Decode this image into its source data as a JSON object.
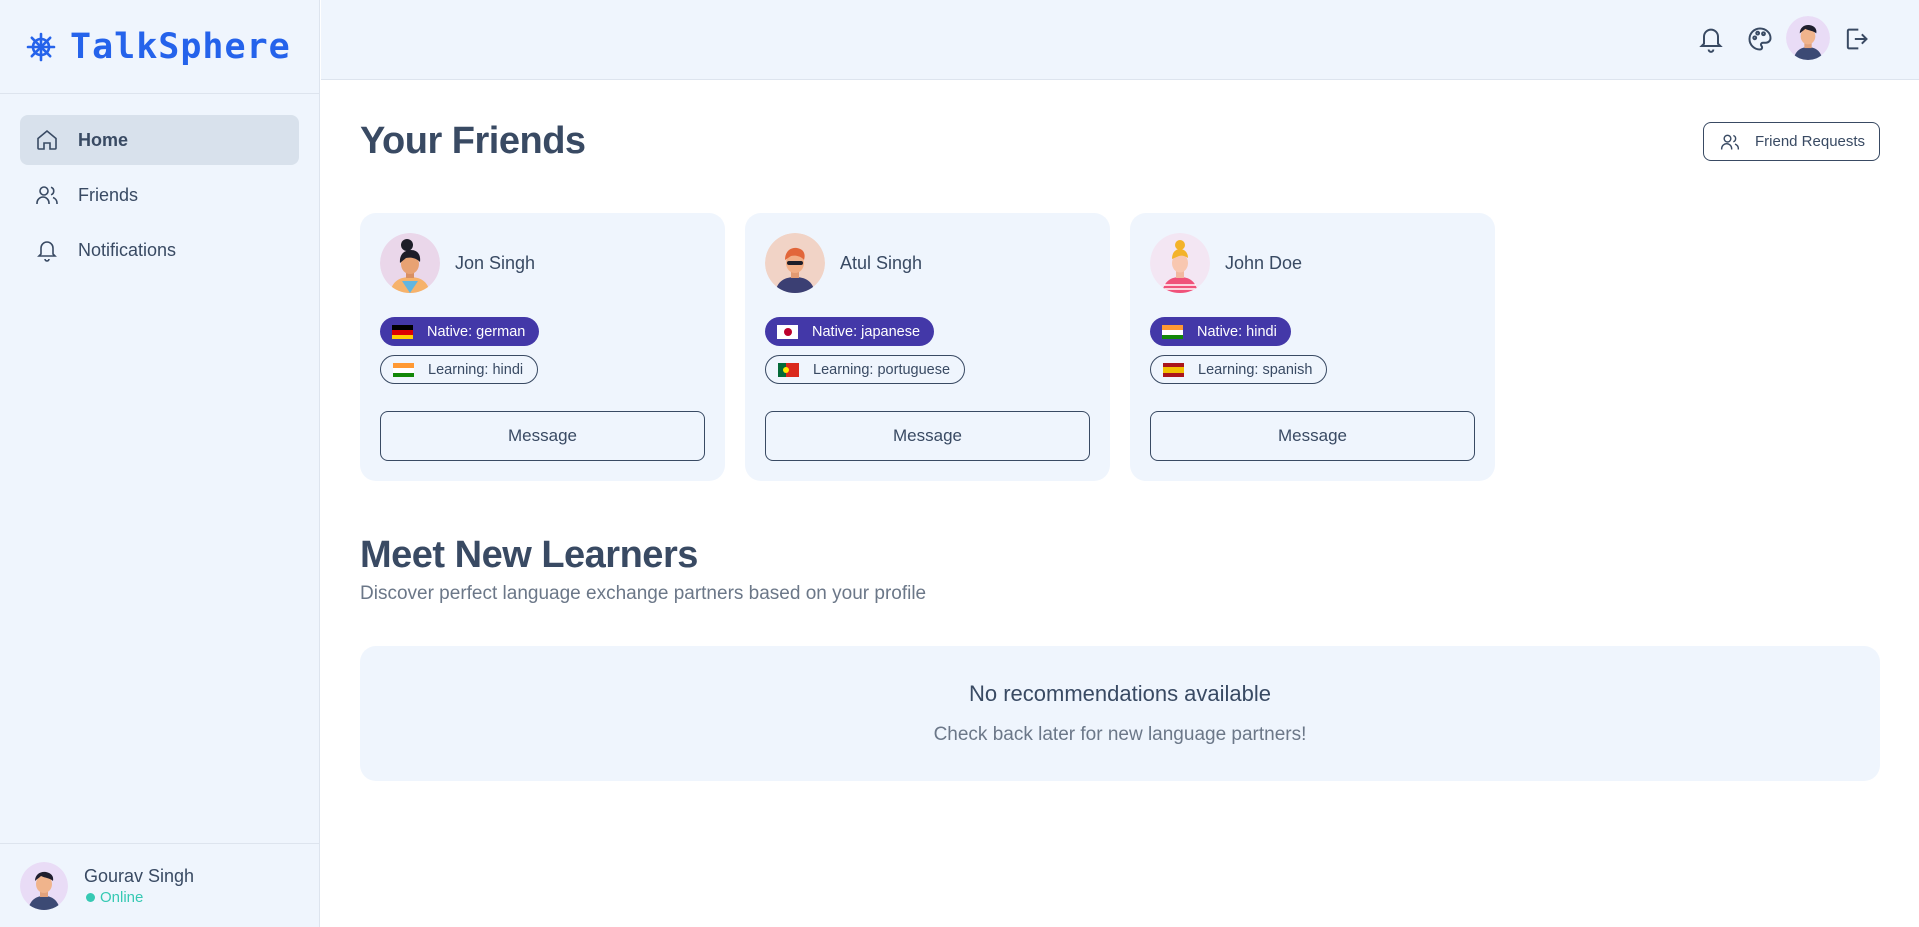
{
  "app": {
    "title": "TalkSphere",
    "brand_color": "#2563eb"
  },
  "sidebar": {
    "items": [
      {
        "label": "Home",
        "icon": "home-icon",
        "active": true
      },
      {
        "label": "Friends",
        "icon": "users-icon",
        "active": false
      },
      {
        "label": "Notifications",
        "icon": "bell-icon",
        "active": false
      }
    ],
    "user": {
      "name": "Gourav Singh",
      "status": "Online"
    }
  },
  "topbar": {
    "icons": [
      "bell-icon",
      "palette-icon",
      "avatar",
      "logout-icon"
    ]
  },
  "friends": {
    "title": "Your Friends",
    "requests_label": "Friend Requests",
    "list": [
      {
        "name": "Jon Singh",
        "native": "Native: german",
        "learning": "Learning: hindi",
        "message_label": "Message"
      },
      {
        "name": "Atul Singh",
        "native": "Native: japanese",
        "learning": "Learning: portuguese",
        "message_label": "Message"
      },
      {
        "name": "John Doe",
        "native": "Native: hindi",
        "learning": "Learning: spanish",
        "message_label": "Message"
      }
    ]
  },
  "learners": {
    "title": "Meet New Learners",
    "subtitle": "Discover perfect language exchange partners based on your profile",
    "empty_title": "No recommendations available",
    "empty_text": "Check back later for new language partners!"
  },
  "colors": {
    "native_badge": "#4338a8",
    "status_online": "#36c9b3",
    "panel_bg": "#eff5fd"
  }
}
